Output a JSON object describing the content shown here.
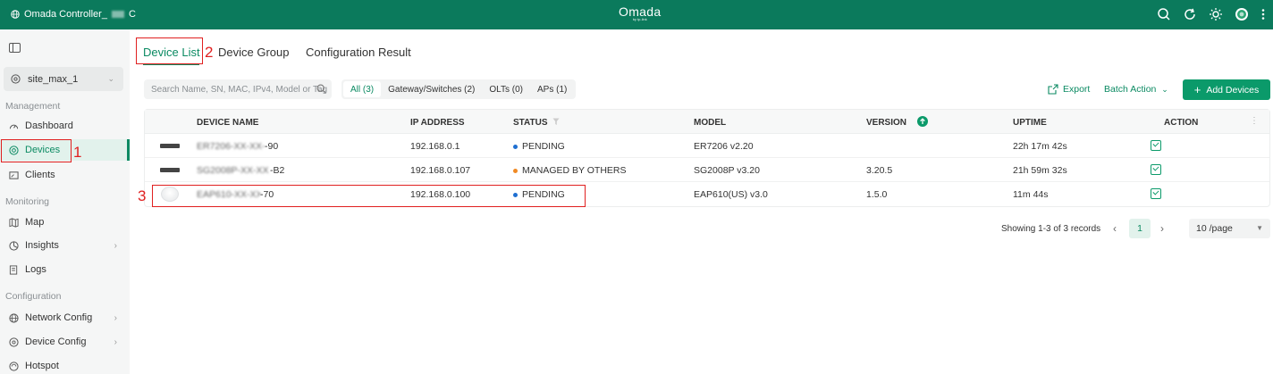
{
  "topbar": {
    "controller_name": "Omada Controller_",
    "controller_suffix": "C",
    "brand": "Omada",
    "brand_sub": "by tp-link",
    "icons": [
      "search-icon",
      "refresh-icon",
      "theme-icon",
      "avatar",
      "more-icon"
    ]
  },
  "sidebar": {
    "site": "site_max_1",
    "sections": {
      "management": "Management",
      "monitoring": "Monitoring",
      "configuration": "Configuration"
    },
    "items": {
      "dashboard": "Dashboard",
      "devices": "Devices",
      "clients": "Clients",
      "map": "Map",
      "insights": "Insights",
      "logs": "Logs",
      "network_config": "Network Config",
      "device_config": "Device Config",
      "hotspot": "Hotspot"
    }
  },
  "tabs": {
    "device_list": "Device List",
    "device_group": "Device Group",
    "configuration_result": "Configuration Result"
  },
  "toolbar": {
    "search_placeholder": "Search Name, SN, MAC, IPv4, Model or Tag",
    "filters": {
      "all": "All (3)",
      "gateway_switches": "Gateway/Switches (2)",
      "olts": "OLTs (0)",
      "aps": "APs (1)"
    },
    "export": "Export",
    "batch_action": "Batch Action",
    "add_devices": "Add Devices"
  },
  "table": {
    "headers": {
      "device_name": "DEVICE NAME",
      "ip_address": "IP ADDRESS",
      "status": "STATUS",
      "model": "MODEL",
      "version": "VERSION",
      "uptime": "UPTIME",
      "action": "ACTION"
    },
    "rows": [
      {
        "name_blurred": "ER7206-XX-XX-XX",
        "name_suffix": "-90",
        "ip": "192.168.0.1",
        "status": "PENDING",
        "status_color": "#1f6fd1",
        "model": "ER7206 v2.20",
        "version": "",
        "uptime": "22h 17m 42s"
      },
      {
        "name_blurred": "SG2008P-XX-XX",
        "name_suffix": "-B2",
        "ip": "192.168.0.107",
        "status": "MANAGED BY OTHERS",
        "status_color": "#f08a24",
        "model": "SG2008P v3.20",
        "version": "3.20.5",
        "uptime": "21h 59m 32s"
      },
      {
        "name_blurred": "EAP610-XX-XX-XX",
        "name_suffix": "-70",
        "ip": "192.168.0.100",
        "status": "PENDING",
        "status_color": "#1f6fd1",
        "model": "EAP610(US) v3.0",
        "version": "1.5.0",
        "uptime": "11m 44s"
      }
    ]
  },
  "pagination": {
    "summary": "Showing 1-3 of 3 records",
    "page": "1",
    "page_size": "10 /page"
  },
  "annotations": {
    "one": "1",
    "two": "2",
    "three": "3"
  }
}
